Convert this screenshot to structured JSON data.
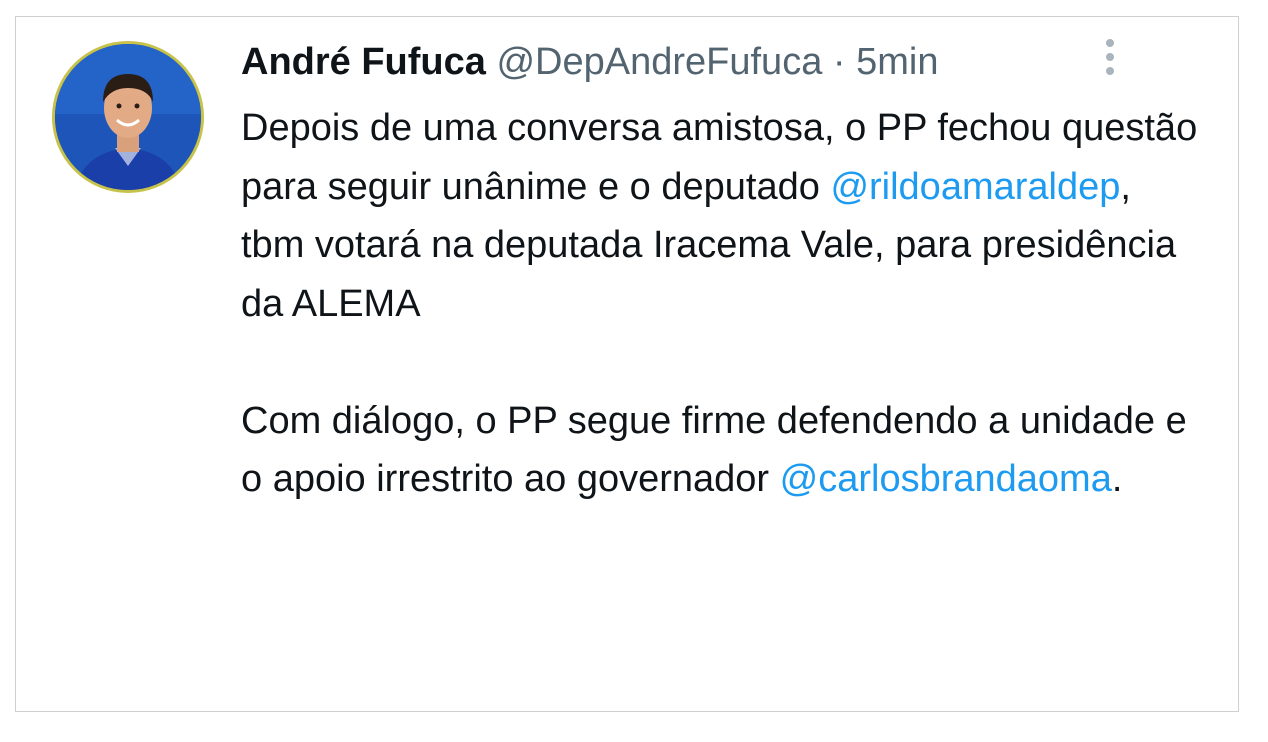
{
  "tweet": {
    "author": {
      "name": "André Fufuca",
      "handle": "@DepAndreFufuca",
      "separator": "·",
      "time": "5min"
    },
    "more_icon": "more-vertical-icon",
    "body": {
      "p1_part1": "Depois de uma conversa amistosa, o PP fechou questão para seguir unânime e o deputado ",
      "p1_mention": "@rildoamaraldep",
      "p1_part2": ", tbm votará na deputada Iracema Vale, para presidência da ALEMA",
      "p2_part1": "Com diálogo, o PP segue firme defendendo a unidade e o apoio irrestrito ao governador ",
      "p2_mention": "@carlosbrandaoma",
      "p2_part2": "."
    },
    "colors": {
      "text": "#0f1419",
      "secondary": "#536471",
      "mention": "#1d9bf0",
      "avatar_bg": "#1d55b8",
      "avatar_ring": "#c7c24a"
    }
  }
}
